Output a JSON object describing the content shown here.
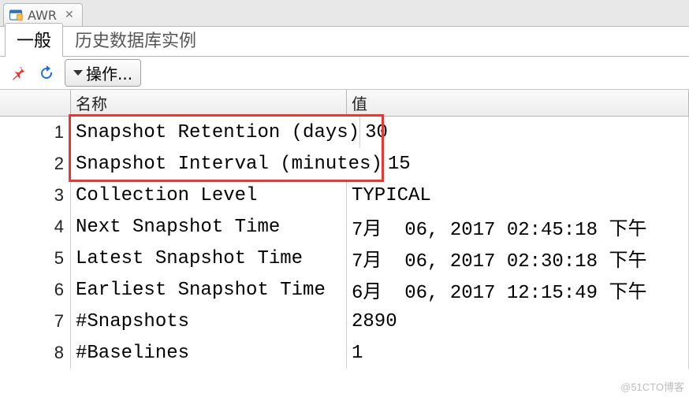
{
  "window_tab": {
    "title": "AWR"
  },
  "inner_tabs": {
    "general": "一般",
    "history": "历史数据库实例"
  },
  "toolbar": {
    "actions_label": "操作..."
  },
  "table": {
    "headers": {
      "name": "名称",
      "value": "值"
    },
    "rows": [
      {
        "n": "1",
        "name": "Snapshot Retention (days)",
        "value": "30"
      },
      {
        "n": "2",
        "name": "Snapshot Interval (minutes)",
        "value": "15"
      },
      {
        "n": "3",
        "name": "Collection Level",
        "value": "TYPICAL"
      },
      {
        "n": "4",
        "name": "Next Snapshot Time",
        "value": "7月  06, 2017 02:45:18 下午"
      },
      {
        "n": "5",
        "name": "Latest Snapshot Time",
        "value": "7月  06, 2017 02:30:18 下午"
      },
      {
        "n": "6",
        "name": "Earliest Snapshot Time",
        "value": "6月  06, 2017 12:15:49 下午"
      },
      {
        "n": "7",
        "name": "#Snapshots",
        "value": "2890"
      },
      {
        "n": "8",
        "name": "#Baselines",
        "value": "1"
      }
    ]
  },
  "highlight": {
    "row_start": 0,
    "row_end": 1
  },
  "watermark": "@51CTO博客"
}
